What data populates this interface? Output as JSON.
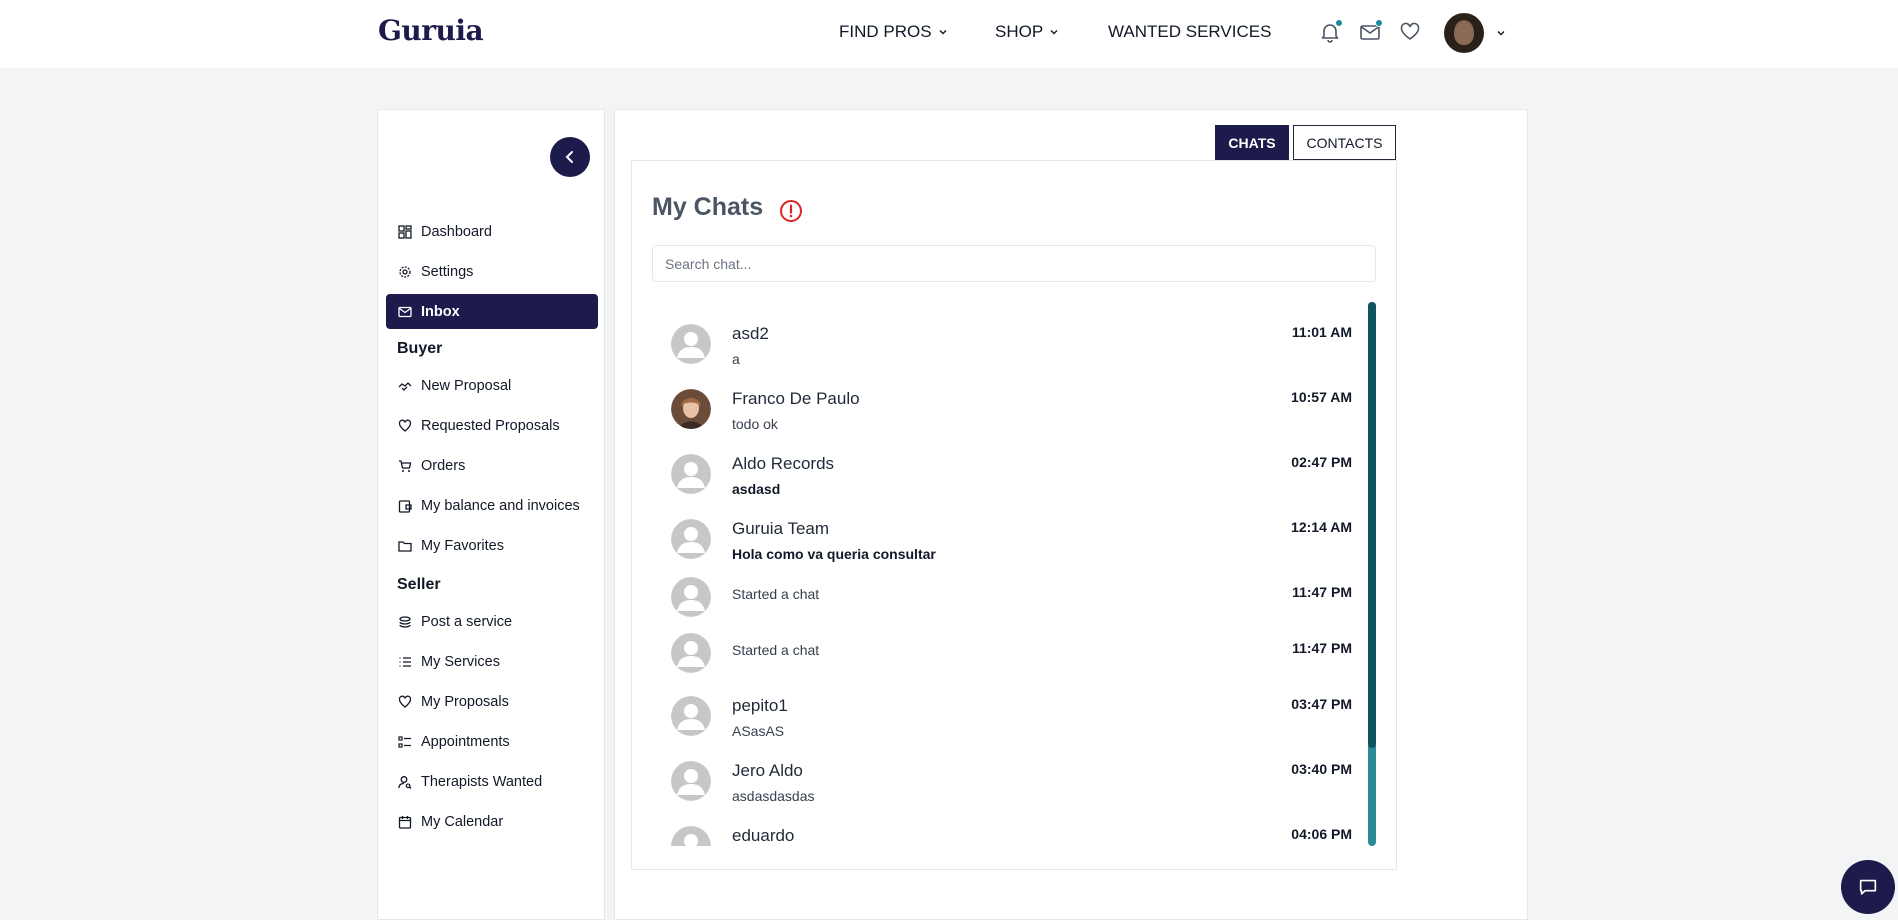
{
  "header": {
    "logo": "Guruia",
    "nav": [
      {
        "label": "FIND PROS"
      },
      {
        "label": "SHOP"
      },
      {
        "label": "WANTED SERVICES"
      }
    ]
  },
  "sidebar": {
    "items": [
      {
        "label": "Dashboard",
        "icon": "grid-icon"
      },
      {
        "label": "Settings",
        "icon": "gear-icon"
      },
      {
        "label": "Inbox",
        "icon": "mail-icon"
      }
    ],
    "buyer_title": "Buyer",
    "buyer_items": [
      {
        "label": "New Proposal",
        "icon": "handshake-icon"
      },
      {
        "label": "Requested Proposals",
        "icon": "heart-hand-icon"
      },
      {
        "label": "Orders",
        "icon": "cart-icon"
      },
      {
        "label": "My balance and invoices",
        "icon": "wallet-icon"
      },
      {
        "label": "My Favorites",
        "icon": "folder-heart-icon"
      }
    ],
    "seller_title": "Seller",
    "seller_items": [
      {
        "label": "Post a service",
        "icon": "stack-icon"
      },
      {
        "label": "My Services",
        "icon": "list-icon"
      },
      {
        "label": "My Proposals",
        "icon": "heart-hand-icon"
      },
      {
        "label": "Appointments",
        "icon": "checklist-icon"
      },
      {
        "label": "Therapists Wanted",
        "icon": "user-search-icon"
      },
      {
        "label": "My Calendar",
        "icon": "calendar-icon"
      }
    ]
  },
  "tabs": {
    "chats": "CHATS",
    "contacts": "CONTACTS"
  },
  "chats": {
    "title": "My Chats",
    "search_placeholder": "Search chat...",
    "list": [
      {
        "name": "asd2",
        "message": "a",
        "time": "11:01 AM",
        "bold": false,
        "photo": false
      },
      {
        "name": "Franco De Paulo",
        "message": "todo ok",
        "time": "10:57 AM",
        "bold": false,
        "photo": true
      },
      {
        "name": "Aldo Records",
        "message": "asdasd",
        "time": "02:47 PM",
        "bold": true,
        "photo": false
      },
      {
        "name": "Guruia Team",
        "message": "Hola como va queria consultar",
        "time": "12:14 AM",
        "bold": true,
        "photo": false
      },
      {
        "name": "",
        "message": "Started a chat",
        "time": "11:47 PM",
        "bold": false,
        "photo": false
      },
      {
        "name": "",
        "message": "Started a chat",
        "time": "11:47 PM",
        "bold": false,
        "photo": false
      },
      {
        "name": "pepito1",
        "message": "ASasAS",
        "time": "03:47 PM",
        "bold": false,
        "photo": false
      },
      {
        "name": "Jero Aldo",
        "message": "asdasdasdas",
        "time": "03:40 PM",
        "bold": false,
        "photo": false
      },
      {
        "name": "eduardo",
        "message": "",
        "time": "04:06 PM",
        "bold": false,
        "photo": false
      }
    ]
  },
  "colors": {
    "brand": "#1d1b4b",
    "accent": "#1b8a9e",
    "scroll_track": "#2b8a97",
    "scroll_thumb": "#12545e"
  }
}
